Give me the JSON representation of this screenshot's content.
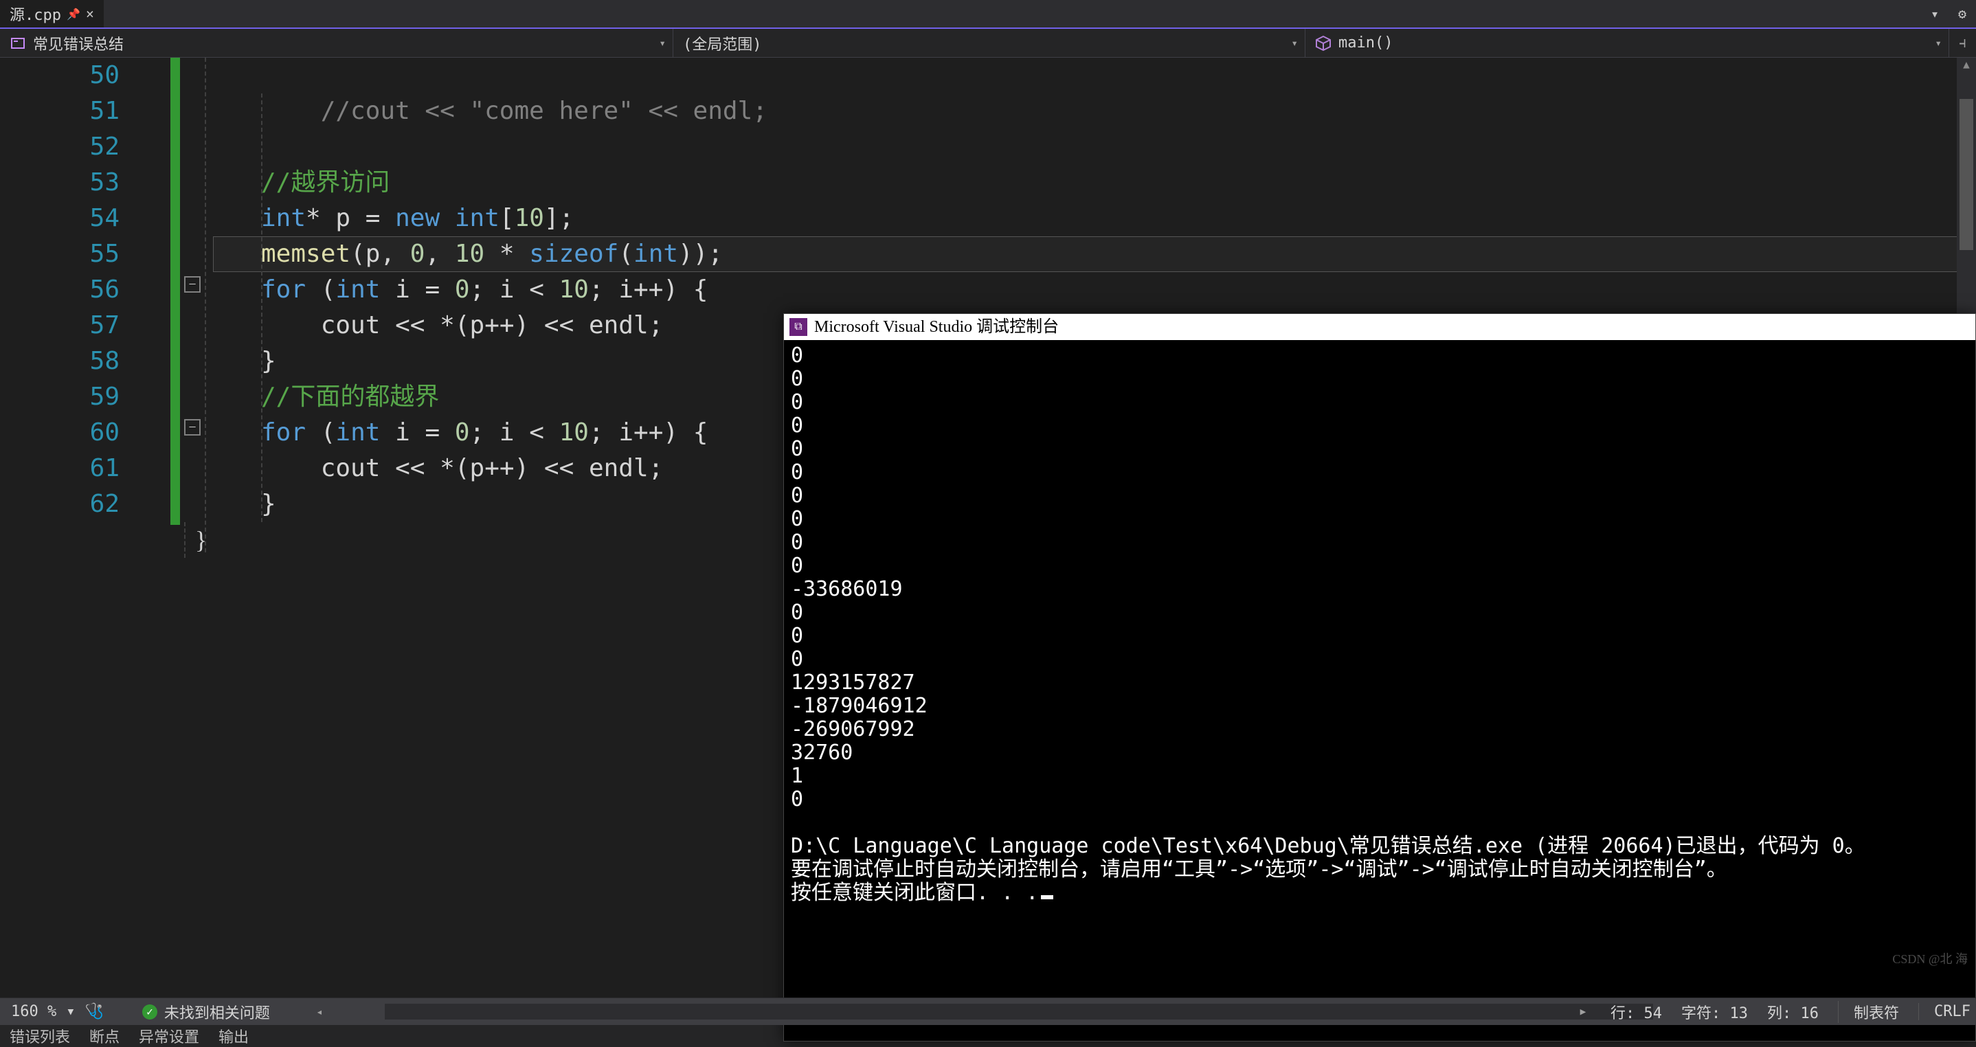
{
  "tab": {
    "title": "源.cpp",
    "pinned": true
  },
  "nav": {
    "scope_project": "常见错误总结",
    "scope_global": "(全局范围)",
    "scope_member": "main()"
  },
  "editor": {
    "line_start": 50,
    "line_end": 62,
    "blank_above_label": "",
    "current_line": 54,
    "lines": [
      {
        "n": 50,
        "html": ""
      },
      {
        "n": 51,
        "html": ""
      },
      {
        "n": 52,
        "html": "<span class='c-comment'>//越界访问</span>"
      },
      {
        "n": 53,
        "html": "<span class='c-type'>int</span><span class='c-op'>*</span> p <span class='c-op'>=</span> <span class='c-kw'>new</span> <span class='c-type'>int</span><span class='c-paren'>[</span><span class='c-num'>10</span><span class='c-paren'>]</span><span class='c-op'>;</span>"
      },
      {
        "n": 54,
        "html": "<span class='c-fn'>memset</span><span class='c-paren'>(</span>p<span class='c-op'>,</span> <span class='c-num'>0</span><span class='c-op'>,</span> <span class='c-num'>10</span> <span class='c-op'>*</span> <span class='c-kw'>sizeof</span><span class='c-paren'>(</span><span class='c-type'>int</span><span class='c-paren'>))</span><span class='c-op'>;</span>"
      },
      {
        "n": 55,
        "html": "<span class='c-kw'>for</span> <span class='c-paren'>(</span><span class='c-type'>int</span> i <span class='c-op'>=</span> <span class='c-num'>0</span><span class='c-op'>;</span> i <span class='c-op'>&lt;</span> <span class='c-num'>10</span><span class='c-op'>;</span> i<span class='c-op'>++</span><span class='c-paren'>)</span> <span class='c-paren'>{</span>"
      },
      {
        "n": 56,
        "html": "    cout <span class='c-op'>&lt;&lt;</span> <span class='c-op'>*</span><span class='c-paren'>(</span>p<span class='c-op'>++</span><span class='c-paren'>)</span> <span class='c-op'>&lt;&lt;</span> endl<span class='c-op'>;</span>"
      },
      {
        "n": 57,
        "html": "<span class='c-paren'>}</span>"
      },
      {
        "n": 58,
        "html": "<span class='c-comment'>//下面的都越界</span>"
      },
      {
        "n": 59,
        "html": "<span class='c-kw'>for</span> <span class='c-paren'>(</span><span class='c-type'>int</span> i <span class='c-op'>=</span> <span class='c-num'>0</span><span class='c-op'>;</span> i <span class='c-op'>&lt;</span> <span class='c-num'>10</span><span class='c-op'>;</span> i<span class='c-op'>++</span><span class='c-paren'>)</span> <span class='c-paren'>{</span>"
      },
      {
        "n": 60,
        "html": "    cout <span class='c-op'>&lt;&lt;</span> <span class='c-op'>*</span><span class='c-paren'>(</span>p<span class='c-op'>++</span><span class='c-paren'>)</span> <span class='c-op'>&lt;&lt;</span> endl<span class='c-op'>;</span>"
      },
      {
        "n": 61,
        "html": "<span class='c-paren'>}</span>"
      },
      {
        "n": 62,
        "html": ""
      }
    ],
    "prev_line_ghost": "//cout << \"come here\" << endl;",
    "closing_brace": "}"
  },
  "console": {
    "title": "Microsoft Visual Studio 调试控制台",
    "output": "0\n0\n0\n0\n0\n0\n0\n0\n0\n0\n-33686019\n0\n0\n0\n1293157827\n-1879046912\n-269067992\n32760\n1\n0\n\nD:\\C Language\\C Language code\\Test\\x64\\Debug\\常见错误总结.exe (进程 20664)已退出，代码为 0。\n要在调试停止时自动关闭控制台，请启用“工具”->“选项”->“调试”->“调试停止时自动关闭控制台”。\n按任意键关闭此窗口. . ."
  },
  "status": {
    "zoom": "160 %",
    "issues": "未找到相关问题",
    "line_label": "行:",
    "line": "54",
    "char_label": "字符:",
    "char": "13",
    "col_label": "列:",
    "col": "16",
    "tabs": "制表符",
    "eol": "CRLF"
  },
  "bottom_tabs": [
    "错误列表",
    "断点",
    "异常设置",
    "输出"
  ],
  "watermark": "CSDN @北 海"
}
